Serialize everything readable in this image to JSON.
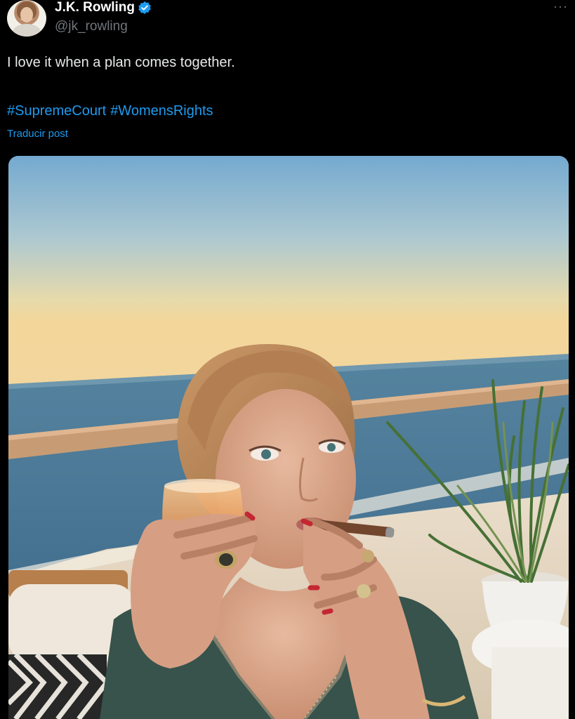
{
  "tweet": {
    "author": {
      "display_name": "J.K. Rowling",
      "handle": "@jk_rowling",
      "verified": true
    },
    "more_label": "···",
    "text": "I love it when a plan comes together.",
    "hashtags": [
      "#SupremeCourt",
      "#WomensRights"
    ],
    "translate_label": "Traducir post"
  },
  "colors": {
    "background": "#000000",
    "primary_text": "#e7e9ea",
    "secondary_text": "#71767b",
    "link": "#1d9bf0",
    "verified_badge": "#1d9bf0"
  },
  "icons": {
    "verified": "verified-badge-icon",
    "more": "more-options-icon"
  }
}
